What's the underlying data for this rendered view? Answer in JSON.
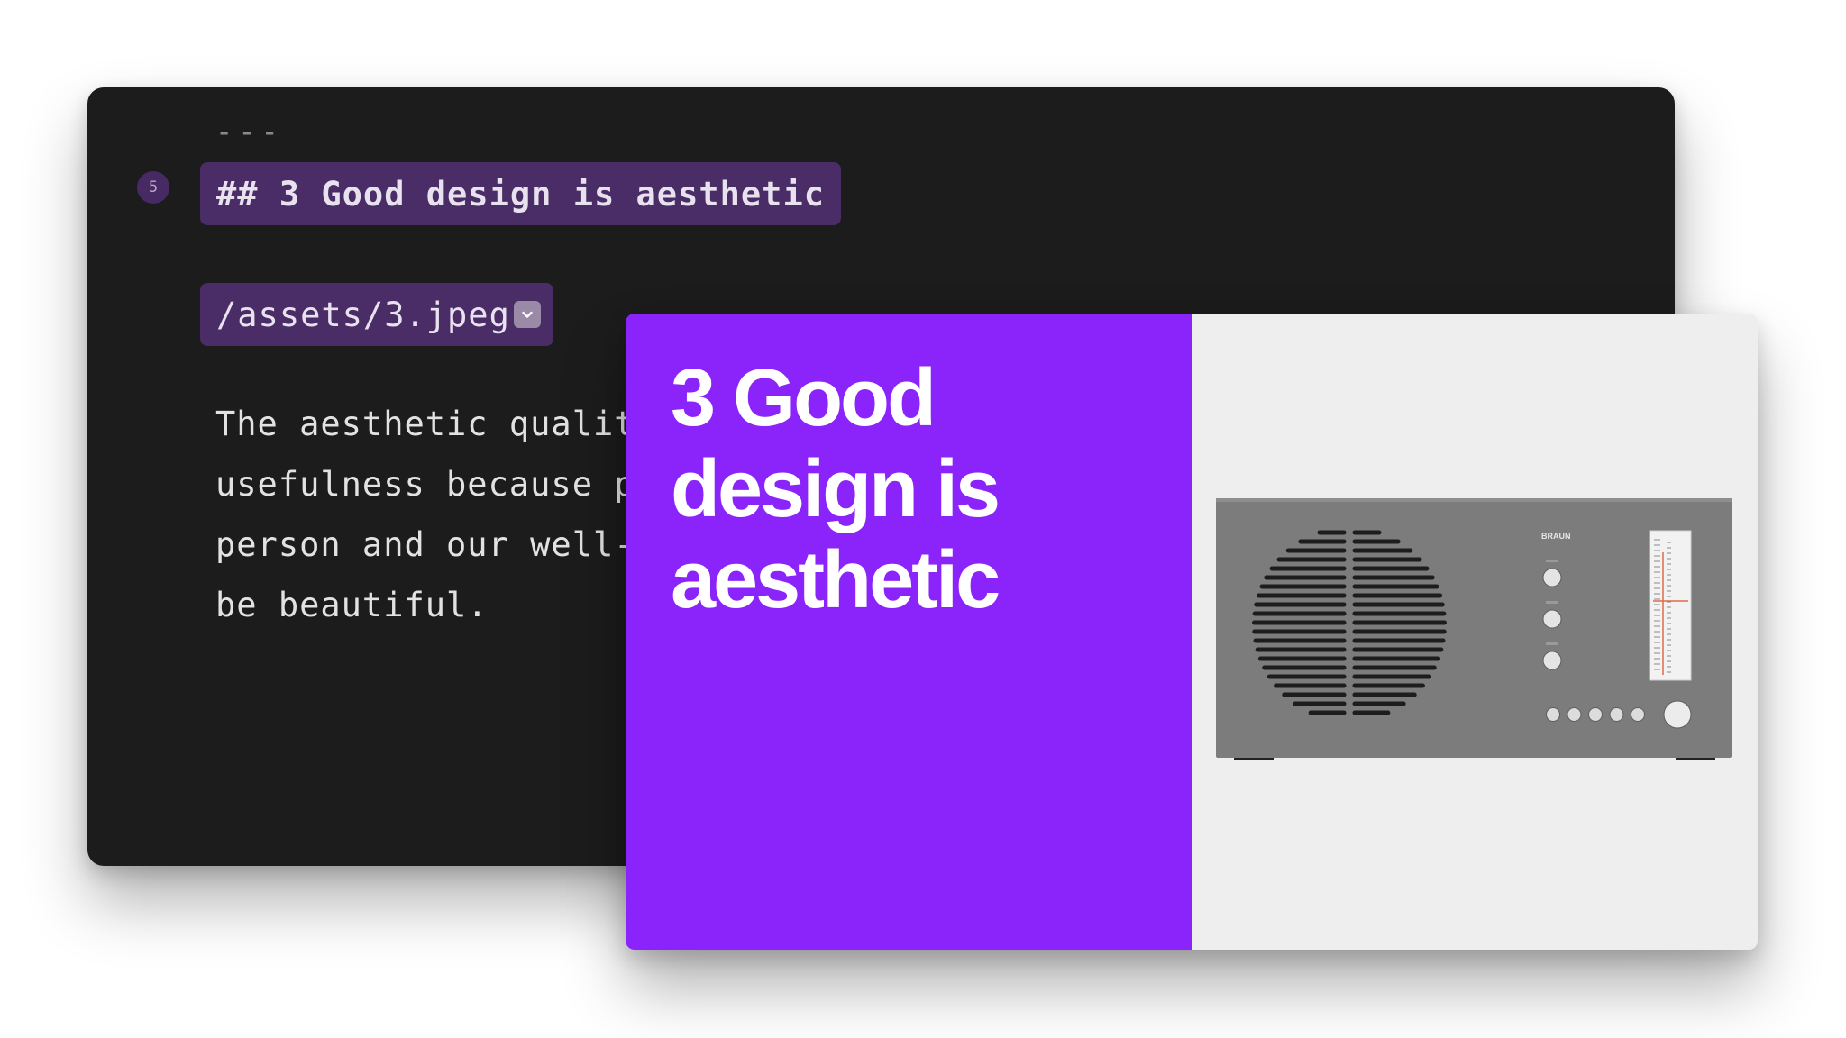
{
  "editor": {
    "separator": "---",
    "slide_number": "5",
    "heading": "## 3 Good design is aesthetic",
    "asset_path": "/assets/3.jpeg",
    "asset_dropdown_icon": "chevron-down-icon",
    "body_lines": [
      "The aesthetic quality of a product is integral to its",
      "usefulness because products we use every day affect our",
      "person and our well-being. But only well-executed objects can",
      "be beautiful."
    ]
  },
  "slide": {
    "title_lines": [
      "3 Good",
      "design is",
      "aesthetic"
    ],
    "image": {
      "description_icon": "radio-product-image",
      "brand_text": "BRAUN"
    }
  },
  "colors": {
    "editor_bg": "#1c1c1c",
    "highlight": "#4a2c66",
    "slide_accent": "#8a24fb",
    "slide_image_bg": "#eeeeee"
  }
}
